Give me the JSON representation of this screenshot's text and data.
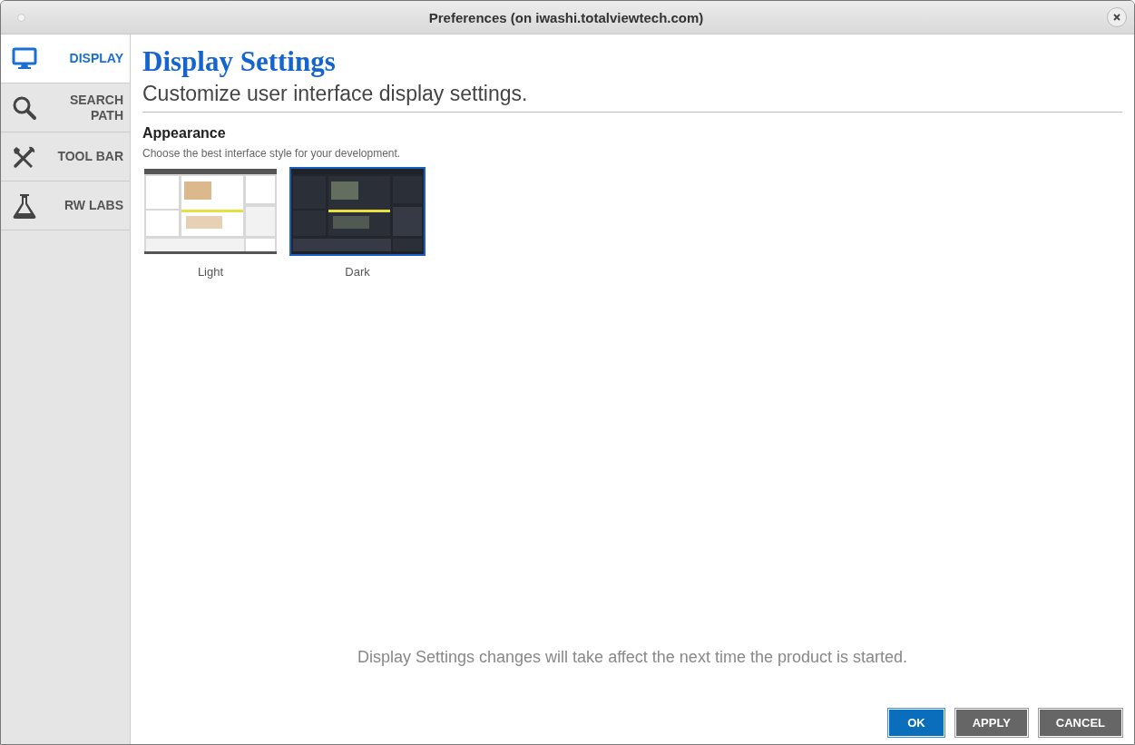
{
  "window": {
    "title": "Preferences (on iwashi.totalviewtech.com)"
  },
  "sidebar": {
    "items": [
      {
        "label": "DISPLAY",
        "kind": "monitor",
        "selected": true
      },
      {
        "label": "SEARCH PATH",
        "kind": "search",
        "selected": false
      },
      {
        "label": "TOOL BAR",
        "kind": "tools",
        "selected": false
      },
      {
        "label": "RW LABS",
        "kind": "flask",
        "selected": false
      }
    ]
  },
  "heading": "Display Settings",
  "subheading": "Customize user interface display settings.",
  "section": {
    "title": "Appearance",
    "description": "Choose the best interface style for your development.",
    "themes": [
      {
        "label": "Light",
        "kind": "light",
        "selected": false
      },
      {
        "label": "Dark",
        "kind": "dark",
        "selected": true
      }
    ]
  },
  "notice": "Display Settings changes will take affect the next time the product is started.",
  "buttons": [
    {
      "label": "OK",
      "kind": "primary"
    },
    {
      "label": "APPLY",
      "kind": "secondary"
    },
    {
      "label": "CANCEL",
      "kind": "secondary"
    }
  ]
}
